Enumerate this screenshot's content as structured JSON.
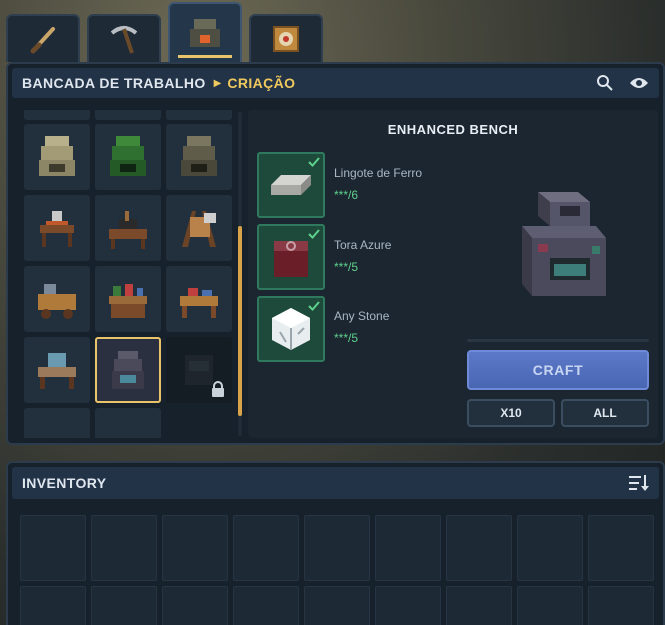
{
  "tabs": [
    {
      "name": "tab-tools",
      "icon": "sword-icon"
    },
    {
      "name": "tab-pickaxe",
      "icon": "pickaxe-icon"
    },
    {
      "name": "tab-workbench",
      "icon": "workbench-icon",
      "active": true
    },
    {
      "name": "tab-target",
      "icon": "target-icon"
    }
  ],
  "header": {
    "crumb_root": "BANCADA DE TRABALHO",
    "crumb_current": "CRIAÇÃO",
    "icons": [
      "search-icon",
      "eye-icon"
    ]
  },
  "recipes": {
    "selected": "enhanced-bench",
    "items": [
      "workbench-sand",
      "workbench-green",
      "workbench-dark",
      "tanning-rack",
      "anvil-bench",
      "hide-rack",
      "cart-bench",
      "alchemy-table",
      "carpentry-bench",
      "loom-bench",
      "enhanced-bench",
      "locked-bench"
    ]
  },
  "detail": {
    "title": "ENHANCED BENCH",
    "ingredients": [
      {
        "name": "Lingote de Ferro",
        "count": "***/6",
        "icon": "iron-ingot-icon"
      },
      {
        "name": "Tora Azure",
        "count": "***/5",
        "icon": "azure-log-icon"
      },
      {
        "name": "Any Stone",
        "count": "***/5",
        "icon": "stone-icon"
      }
    ],
    "preview_icon": "enhanced-bench-icon",
    "craft_label": "CRAFT",
    "x10_label": "X10",
    "all_label": "ALL"
  },
  "inventory": {
    "title": "INVENTORY",
    "sort_icon": "sort-icon"
  },
  "colors": {
    "accent_gold": "#f0c95e",
    "craft_button": "#4966b3",
    "success_green": "#5fd08b",
    "ingredient_bg": "#1e4a3c"
  }
}
